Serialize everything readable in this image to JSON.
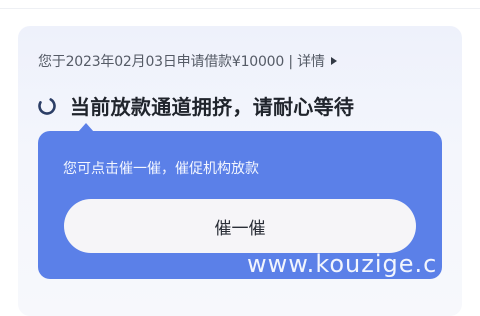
{
  "loan": {
    "application_text": "您于2023年02月03日申请借款¥10000 | 详情"
  },
  "status": {
    "text": "当前放款通道拥挤，请耐心等待"
  },
  "urge": {
    "hint": "您可点击催一催，催促机构放款",
    "button_label": "催一催"
  },
  "watermark": {
    "text": "www.kouzige.c"
  },
  "colors": {
    "accent": "#5b80e8",
    "card_bg": "#f2f4fb",
    "button_bg": "#f6f5f8"
  }
}
